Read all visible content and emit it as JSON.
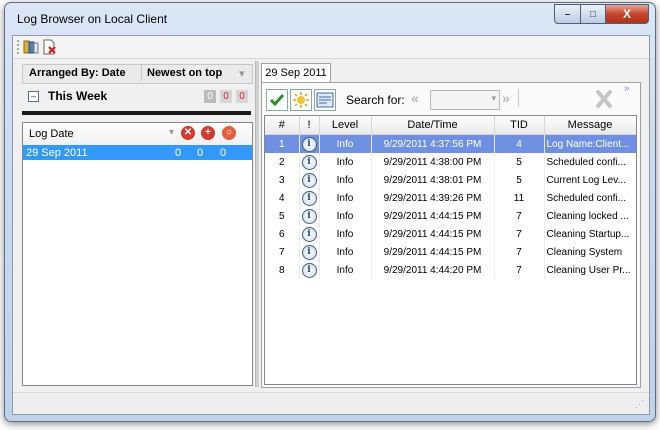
{
  "window": {
    "title": "Log Browser on Local Client",
    "min_label": "–",
    "max_label": "□",
    "close_label": "X"
  },
  "toolbar": {
    "open_icon": "open-log-icon",
    "delete_icon": "delete-log-icon"
  },
  "left": {
    "arranged_label": "Arranged By: Date",
    "newest_label": "Newest on top",
    "group": {
      "toggle": "–",
      "label": "This Week",
      "counts": [
        "0",
        "0",
        "0"
      ]
    },
    "list_header": "Log Date",
    "rows": [
      {
        "date": "29 Sep 2011",
        "a": "0",
        "b": "0",
        "c": "0"
      }
    ]
  },
  "right": {
    "tab": "29 Sep 2011",
    "search_label": "Search for:",
    "search_value": "",
    "columns": [
      "#",
      "!",
      "Level",
      "Date/Time",
      "TID",
      "Message"
    ],
    "rows": [
      {
        "n": "1",
        "level": "Info",
        "datetime": "9/29/2011 4:37:56 PM",
        "tid": "4",
        "msg": "Log Name:Client..."
      },
      {
        "n": "2",
        "level": "Info",
        "datetime": "9/29/2011 4:38:00 PM",
        "tid": "5",
        "msg": "Scheduled confi..."
      },
      {
        "n": "3",
        "level": "Info",
        "datetime": "9/29/2011 4:38:01 PM",
        "tid": "5",
        "msg": "Current Log Lev..."
      },
      {
        "n": "4",
        "level": "Info",
        "datetime": "9/29/2011 4:39:26 PM",
        "tid": "11",
        "msg": "Scheduled confi..."
      },
      {
        "n": "5",
        "level": "Info",
        "datetime": "9/29/2011 4:44:15 PM",
        "tid": "7",
        "msg": "Cleaning locked ..."
      },
      {
        "n": "6",
        "level": "Info",
        "datetime": "9/29/2011 4:44:15 PM",
        "tid": "7",
        "msg": "Cleaning Startup..."
      },
      {
        "n": "7",
        "level": "Info",
        "datetime": "9/29/2011 4:44:15 PM",
        "tid": "7",
        "msg": "Cleaning System"
      },
      {
        "n": "8",
        "level": "Info",
        "datetime": "9/29/2011 4:44:20 PM",
        "tid": "7",
        "msg": "Cleaning User Pr..."
      }
    ],
    "selected_row": 0
  },
  "colors": {
    "selection": "#3399ff",
    "row_selected": "#6f8fe3",
    "badge": "#d22"
  }
}
